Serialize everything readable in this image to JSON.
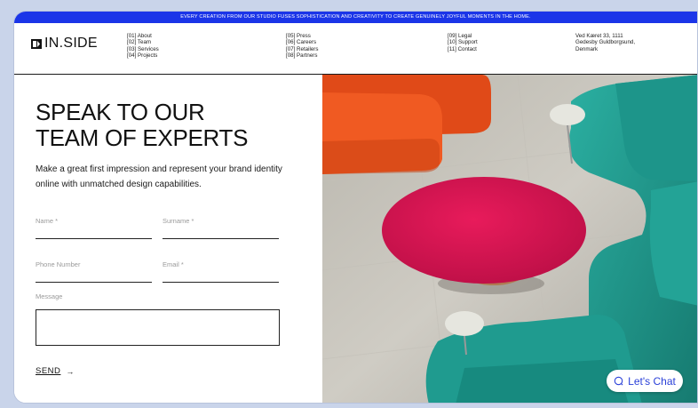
{
  "banner": {
    "text": "EVERY CREATION FROM OUR STUDIO FUSES SOPHISTICATION AND CREATIVITY TO CREATE GENUINELY JOYFUL MOMENTS IN THE HOME."
  },
  "brand": {
    "name": "IN.SIDE"
  },
  "nav": {
    "col1": [
      "[01] About",
      "[02] Team",
      "[03] Services",
      "[04] Projects"
    ],
    "col2": [
      "[05] Press",
      "[06] Careers",
      "[07] Retailers",
      "[08] Partners"
    ],
    "col3": [
      "[09] Legal",
      "[10] Support",
      "[11] Contact"
    ]
  },
  "address": [
    "Ved Kæret 33, 1111",
    "Gedesby Guldborgsund,",
    "Denmark"
  ],
  "hero": {
    "line1": "SPEAK TO OUR",
    "line2": "TEAM OF EXPERTS",
    "lead": "Make a great first impression and represent your brand identity online with unmatched design capabilities."
  },
  "form": {
    "name_label": "Name *",
    "surname_label": "Surname *",
    "phone_label": "Phone Number",
    "email_label": "Email *",
    "message_label": "Message",
    "send_label": "SEND",
    "send_arrow": "→"
  },
  "chat": {
    "label": "Let's Chat"
  },
  "colors": {
    "accent": "#1b35e8",
    "chat_text": "#2a40d8",
    "sofa_orange": "#e04a18",
    "sofa_teal": "#1f9b8f",
    "table_magenta": "#d6154f"
  },
  "icons": {
    "logo": "logo-mark-icon",
    "chat": "chat-bubble-icon",
    "send": "arrow-right-icon"
  }
}
